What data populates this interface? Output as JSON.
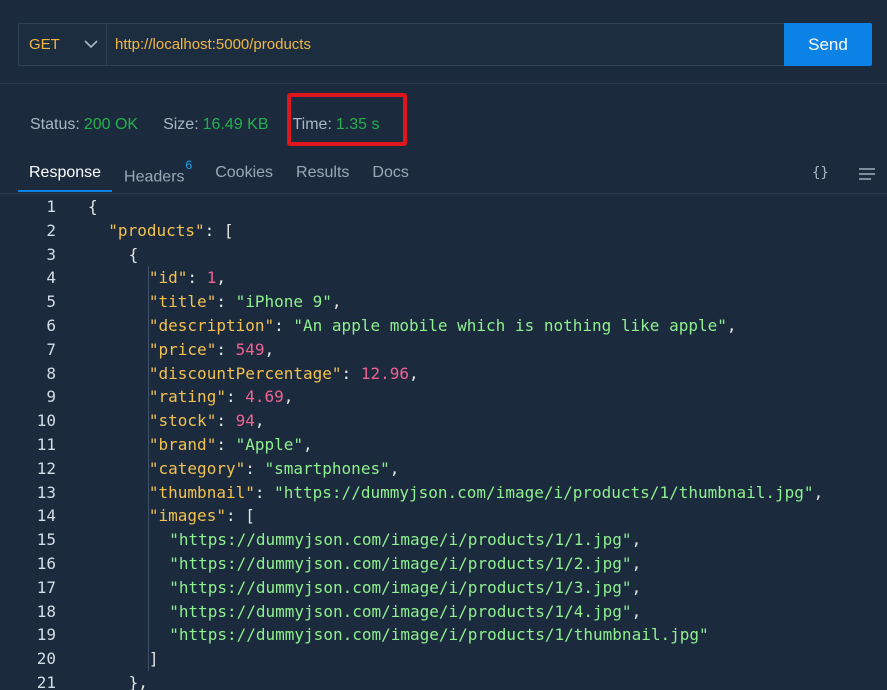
{
  "request": {
    "method": "GET",
    "url": "http://localhost:5000/products",
    "send_label": "Send"
  },
  "status": {
    "status_label": "Status:",
    "status_value": "200 OK",
    "size_label": "Size:",
    "size_value": "16.49 KB",
    "time_label": "Time:",
    "time_value": "1.35 s"
  },
  "tabs": [
    {
      "label": "Response",
      "active": true
    },
    {
      "label": "Headers",
      "badge": "6"
    },
    {
      "label": "Cookies"
    },
    {
      "label": "Results"
    },
    {
      "label": "Docs"
    }
  ],
  "toolbar": {
    "braces_text": "{}",
    "icons": [
      "braces-icon",
      "menu-icon",
      "chevron-down-icon"
    ]
  },
  "colors": {
    "background": "#1b2b3d",
    "accent": "#0b82e6",
    "success": "#22b14c",
    "highlight_box": "#e0161c",
    "json_key": "#f2c14e",
    "json_string": "#8ef08e",
    "json_number": "#f06292"
  },
  "code": {
    "lines": [
      {
        "n": "1",
        "indent": 0,
        "tokens": [
          {
            "t": "{",
            "c": "p"
          }
        ]
      },
      {
        "n": "2",
        "indent": 1,
        "tokens": [
          {
            "t": "\"products\"",
            "c": "k"
          },
          {
            "t": ": [",
            "c": "p"
          }
        ]
      },
      {
        "n": "3",
        "indent": 2,
        "tokens": [
          {
            "t": "{",
            "c": "p"
          }
        ]
      },
      {
        "n": "4",
        "indent": 3,
        "tokens": [
          {
            "t": "\"id\"",
            "c": "k"
          },
          {
            "t": ": ",
            "c": "p"
          },
          {
            "t": "1",
            "c": "n"
          },
          {
            "t": ",",
            "c": "p"
          }
        ]
      },
      {
        "n": "5",
        "indent": 3,
        "tokens": [
          {
            "t": "\"title\"",
            "c": "k"
          },
          {
            "t": ": ",
            "c": "p"
          },
          {
            "t": "\"iPhone 9\"",
            "c": "s"
          },
          {
            "t": ",",
            "c": "p"
          }
        ]
      },
      {
        "n": "6",
        "indent": 3,
        "tokens": [
          {
            "t": "\"description\"",
            "c": "k"
          },
          {
            "t": ": ",
            "c": "p"
          },
          {
            "t": "\"An apple mobile which is nothing like apple\"",
            "c": "s"
          },
          {
            "t": ",",
            "c": "p"
          }
        ]
      },
      {
        "n": "7",
        "indent": 3,
        "tokens": [
          {
            "t": "\"price\"",
            "c": "k"
          },
          {
            "t": ": ",
            "c": "p"
          },
          {
            "t": "549",
            "c": "n"
          },
          {
            "t": ",",
            "c": "p"
          }
        ]
      },
      {
        "n": "8",
        "indent": 3,
        "tokens": [
          {
            "t": "\"discountPercentage\"",
            "c": "k"
          },
          {
            "t": ": ",
            "c": "p"
          },
          {
            "t": "12.96",
            "c": "n"
          },
          {
            "t": ",",
            "c": "p"
          }
        ]
      },
      {
        "n": "9",
        "indent": 3,
        "tokens": [
          {
            "t": "\"rating\"",
            "c": "k"
          },
          {
            "t": ": ",
            "c": "p"
          },
          {
            "t": "4.69",
            "c": "n"
          },
          {
            "t": ",",
            "c": "p"
          }
        ]
      },
      {
        "n": "10",
        "indent": 3,
        "tokens": [
          {
            "t": "\"stock\"",
            "c": "k"
          },
          {
            "t": ": ",
            "c": "p"
          },
          {
            "t": "94",
            "c": "n"
          },
          {
            "t": ",",
            "c": "p"
          }
        ]
      },
      {
        "n": "11",
        "indent": 3,
        "tokens": [
          {
            "t": "\"brand\"",
            "c": "k"
          },
          {
            "t": ": ",
            "c": "p"
          },
          {
            "t": "\"Apple\"",
            "c": "s"
          },
          {
            "t": ",",
            "c": "p"
          }
        ]
      },
      {
        "n": "12",
        "indent": 3,
        "tokens": [
          {
            "t": "\"category\"",
            "c": "k"
          },
          {
            "t": ": ",
            "c": "p"
          },
          {
            "t": "\"smartphones\"",
            "c": "s"
          },
          {
            "t": ",",
            "c": "p"
          }
        ]
      },
      {
        "n": "13",
        "indent": 3,
        "tokens": [
          {
            "t": "\"thumbnail\"",
            "c": "k"
          },
          {
            "t": ": ",
            "c": "p"
          },
          {
            "t": "\"https://dummyjson.com/image/i/products/1/thumbnail.jpg\"",
            "c": "s"
          },
          {
            "t": ",",
            "c": "p"
          }
        ]
      },
      {
        "n": "14",
        "indent": 3,
        "tokens": [
          {
            "t": "\"images\"",
            "c": "k"
          },
          {
            "t": ": [",
            "c": "p"
          }
        ]
      },
      {
        "n": "15",
        "indent": 4,
        "tokens": [
          {
            "t": "\"https://dummyjson.com/image/i/products/1/1.jpg\"",
            "c": "s"
          },
          {
            "t": ",",
            "c": "p"
          }
        ]
      },
      {
        "n": "16",
        "indent": 4,
        "tokens": [
          {
            "t": "\"https://dummyjson.com/image/i/products/1/2.jpg\"",
            "c": "s"
          },
          {
            "t": ",",
            "c": "p"
          }
        ]
      },
      {
        "n": "17",
        "indent": 4,
        "tokens": [
          {
            "t": "\"https://dummyjson.com/image/i/products/1/3.jpg\"",
            "c": "s"
          },
          {
            "t": ",",
            "c": "p"
          }
        ]
      },
      {
        "n": "18",
        "indent": 4,
        "tokens": [
          {
            "t": "\"https://dummyjson.com/image/i/products/1/4.jpg\"",
            "c": "s"
          },
          {
            "t": ",",
            "c": "p"
          }
        ]
      },
      {
        "n": "19",
        "indent": 4,
        "tokens": [
          {
            "t": "\"https://dummyjson.com/image/i/products/1/thumbnail.jpg\"",
            "c": "s"
          }
        ]
      },
      {
        "n": "20",
        "indent": 3,
        "tokens": [
          {
            "t": "]",
            "c": "p"
          }
        ]
      },
      {
        "n": "21",
        "indent": 2,
        "tokens": [
          {
            "t": "},",
            "c": "p"
          }
        ]
      }
    ]
  }
}
